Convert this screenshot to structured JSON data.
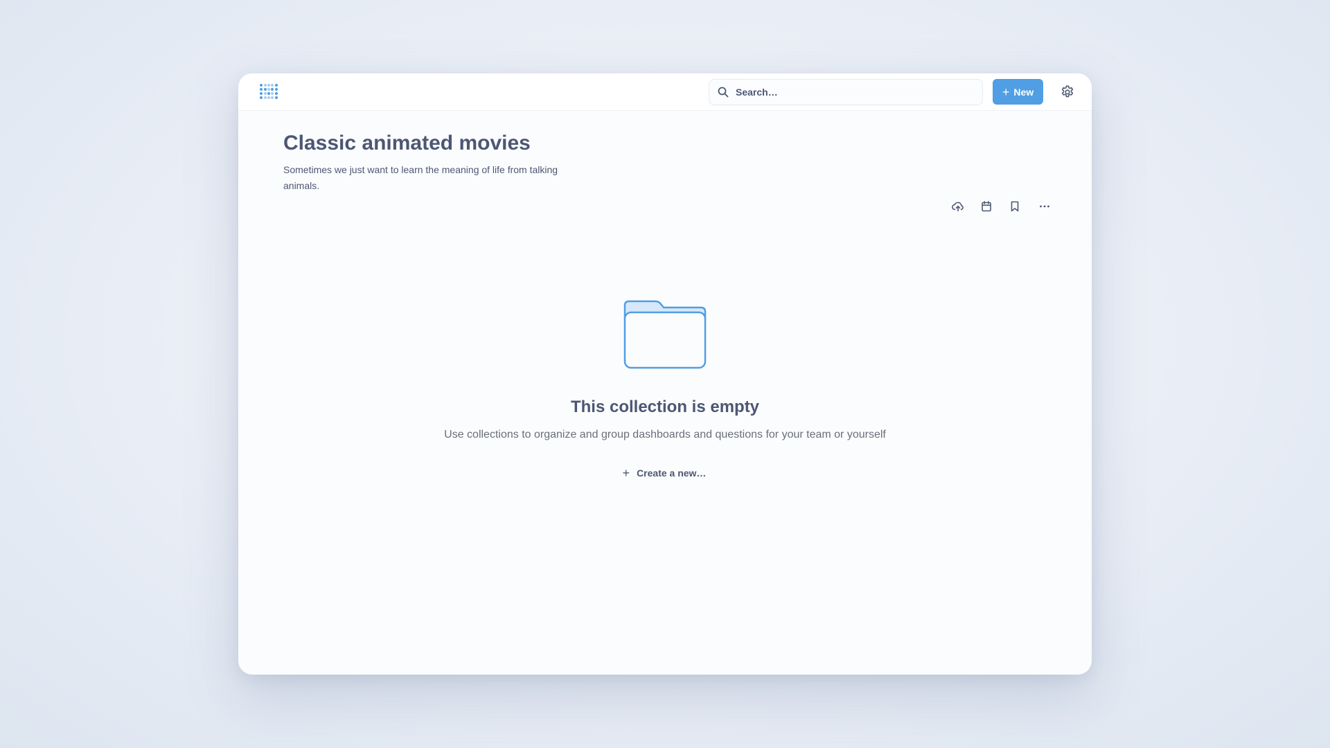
{
  "topbar": {
    "logo_icon": "metabase-logo-icon",
    "search": {
      "placeholder": "Search…",
      "icon": "search-icon"
    },
    "new_button": {
      "label": "New",
      "icon": "plus-icon"
    },
    "settings_icon": "gear-icon"
  },
  "collection": {
    "title": "Classic animated movies",
    "description": "Sometimes we just want to learn the meaning of life from talking animals.",
    "actions": [
      {
        "name": "upload-icon"
      },
      {
        "name": "calendar-icon"
      },
      {
        "name": "bookmark-icon"
      },
      {
        "name": "more-icon"
      }
    ]
  },
  "empty_state": {
    "icon": "folder-icon",
    "title": "This collection is empty",
    "subtitle": "Use collections to organize and group dashboards and questions for your team or yourself",
    "create_button": {
      "label": "Create a new…",
      "icon": "plus-icon"
    }
  },
  "colors": {
    "brand": "#509ee3",
    "text_dark": "#4c5773",
    "text_medium": "#696e7b",
    "folder_stroke": "#509ee3",
    "folder_fill": "#eaf3fc"
  }
}
